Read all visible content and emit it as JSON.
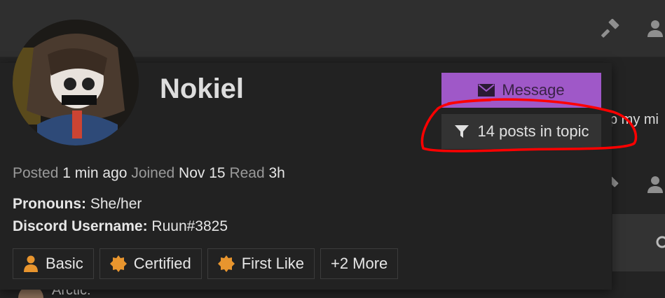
{
  "background": {
    "snippet_text": "p my mi",
    "arctic_text": "Arctic:"
  },
  "card": {
    "username": "Nokiel",
    "message_label": "Message",
    "filter_label": "14 posts in topic",
    "meta": {
      "posted_label": "Posted",
      "posted_value": "1 min ago",
      "joined_label": "Joined",
      "joined_value": "Nov 15",
      "read_label": "Read",
      "read_value": "3h"
    },
    "fields": [
      {
        "label": "Pronouns:",
        "value": "She/her"
      },
      {
        "label": "Discord Username:",
        "value": "Ruun#3825"
      }
    ],
    "badges": [
      {
        "label": "Basic",
        "icon": "user-icon"
      },
      {
        "label": "Certified",
        "icon": "certificate-icon"
      },
      {
        "label": "First Like",
        "icon": "certificate-icon"
      },
      {
        "label": "+2 More",
        "icon": ""
      }
    ]
  },
  "colors": {
    "message_button": "#9f58c8",
    "badge_bronze": "#cd7f32",
    "annotation": "#ff0000"
  }
}
